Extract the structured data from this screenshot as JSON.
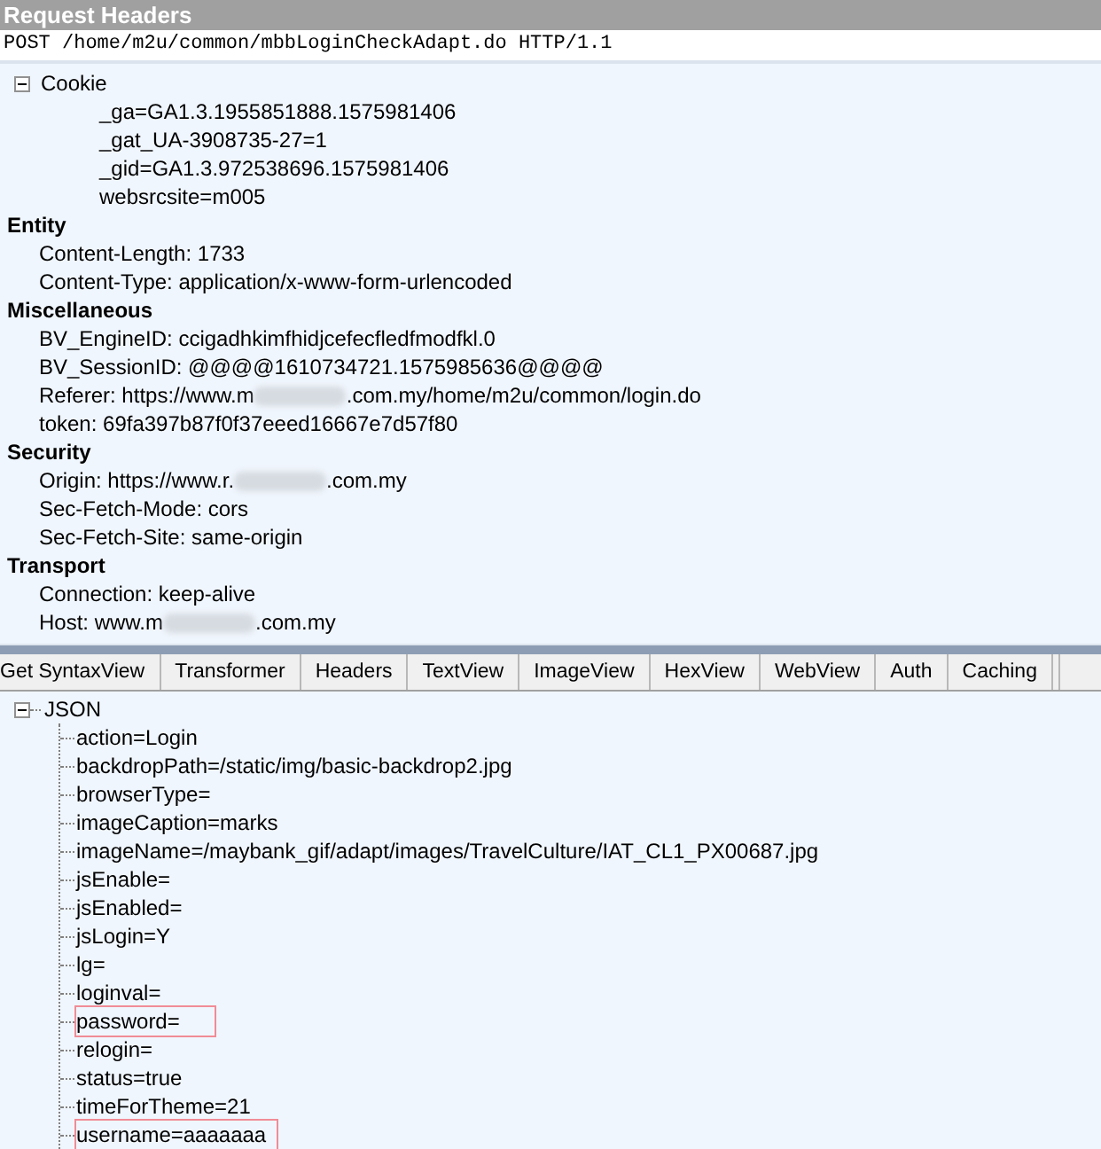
{
  "panel_title": "Request Headers",
  "request_line": "POST /home/m2u/common/mbbLoginCheckAdapt.do HTTP/1.1",
  "header_groups": [
    {
      "name": "Cookie",
      "kind": "collapsible",
      "expanded": true,
      "items": [
        {
          "text": "_ga=GA1.3.1955851888.1575981406"
        },
        {
          "text": "_gat_UA-3908735-27=1"
        },
        {
          "text": "_gid=GA1.3.972538696.1575981406"
        },
        {
          "text": "websrcsite=m005"
        }
      ]
    },
    {
      "name": "Entity",
      "kind": "heading",
      "items": [
        {
          "text": "Content-Length: 1733"
        },
        {
          "text": "Content-Type: application/x-www-form-urlencoded"
        }
      ]
    },
    {
      "name": "Miscellaneous",
      "kind": "heading",
      "items": [
        {
          "text": "BV_EngineID: ccigadhkimfhidjcefecfledfmodfkl.0"
        },
        {
          "text": "BV_SessionID: @@@@1610734721.1575985636@@@@"
        },
        {
          "text": "Referer: https://www.m",
          "after_blur": ".com.my/home/m2u/common/login.do"
        },
        {
          "text": "token: 69fa397b87f0f37eeed16667e7d57f80"
        }
      ]
    },
    {
      "name": "Security",
      "kind": "heading",
      "items": [
        {
          "text": "Origin: https://www.r.",
          "after_blur": ".com.my"
        },
        {
          "text": "Sec-Fetch-Mode: cors"
        },
        {
          "text": "Sec-Fetch-Site: same-origin"
        }
      ]
    },
    {
      "name": "Transport",
      "kind": "heading",
      "items": [
        {
          "text": "Connection: keep-alive"
        },
        {
          "text": "Host: www.m",
          "after_blur": ".com.my"
        }
      ]
    }
  ],
  "tabs": [
    {
      "label": "Get SyntaxView",
      "selected": false
    },
    {
      "label": "Transformer",
      "selected": false
    },
    {
      "label": "Headers",
      "selected": false
    },
    {
      "label": "TextView",
      "selected": false
    },
    {
      "label": "ImageView",
      "selected": false
    },
    {
      "label": "HexView",
      "selected": false
    },
    {
      "label": "WebView",
      "selected": false
    },
    {
      "label": "Auth",
      "selected": false
    },
    {
      "label": "Caching",
      "selected": false
    }
  ],
  "tree": {
    "label": "JSON",
    "expanded": true,
    "children": [
      {
        "text": "action=Login",
        "highlighted": false
      },
      {
        "text": "backdropPath=/static/img/basic-backdrop2.jpg",
        "highlighted": false
      },
      {
        "text": "browserType=",
        "highlighted": false
      },
      {
        "text": "imageCaption=marks",
        "highlighted": false
      },
      {
        "text": "imageName=/maybank_gif/adapt/images/TravelCulture/IAT_CL1_PX00687.jpg",
        "highlighted": false
      },
      {
        "text": "jsEnable=",
        "highlighted": false
      },
      {
        "text": "jsEnabled=",
        "highlighted": false
      },
      {
        "text": "jsLogin=Y",
        "highlighted": false
      },
      {
        "text": "lg=",
        "highlighted": false
      },
      {
        "text": "loginval=",
        "highlighted": false
      },
      {
        "text": "password=",
        "highlighted": true
      },
      {
        "text": "relogin=",
        "highlighted": false
      },
      {
        "text": "status=true",
        "highlighted": false
      },
      {
        "text": "timeForTheme=21",
        "highlighted": false
      },
      {
        "text": "username=aaaaaaa",
        "highlighted": true
      }
    ]
  }
}
